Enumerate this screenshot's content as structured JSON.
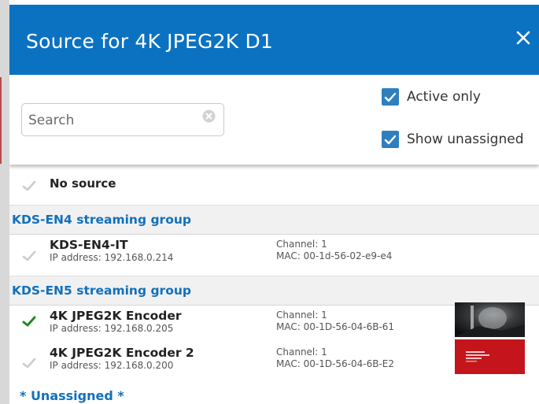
{
  "dialog": {
    "title": "Source for 4K JPEG2K D1",
    "close_icon": "close-icon"
  },
  "filters": {
    "search": {
      "value": "",
      "placeholder": "Search",
      "clear_icon": "clear-search-icon"
    },
    "active_only": {
      "label": "Active only",
      "checked": true
    },
    "show_unassigned": {
      "label": "Show unassigned",
      "checked": true
    }
  },
  "colors": {
    "header": "#0b72c2",
    "accent_text": "#1170bd",
    "selected_check": "#1e8a1e",
    "unselected_check": "#cccccc",
    "checkbox": "#2f7fbf"
  },
  "list": {
    "no_source": {
      "label": "No source",
      "selected": false
    },
    "groups": [
      {
        "name": "KDS-EN4 streaming group",
        "devices": [
          {
            "name": "KDS-EN4-IT",
            "ip": "IP address: 192.168.0.214",
            "channel": "Channel: 1",
            "mac": "MAC: 00-1d-56-02-e9-e4",
            "selected": false,
            "thumbnail": "none"
          }
        ]
      },
      {
        "name": "KDS-EN5 streaming group",
        "devices": [
          {
            "name": "4K JPEG2K Encoder",
            "ip": "IP address: 192.168.0.205",
            "channel": "Channel: 1",
            "mac": "MAC: 00-1D-56-04-6B-61",
            "selected": true,
            "thumbnail": "dark-preview"
          },
          {
            "name": "4K JPEG2K Encoder 2",
            "ip": "IP address: 192.168.0.200",
            "channel": "Channel: 1",
            "mac": "MAC: 00-1D-56-04-6B-E2",
            "selected": false,
            "thumbnail": "red-preview"
          }
        ]
      }
    ],
    "unassigned_label": "* Unassigned *"
  }
}
